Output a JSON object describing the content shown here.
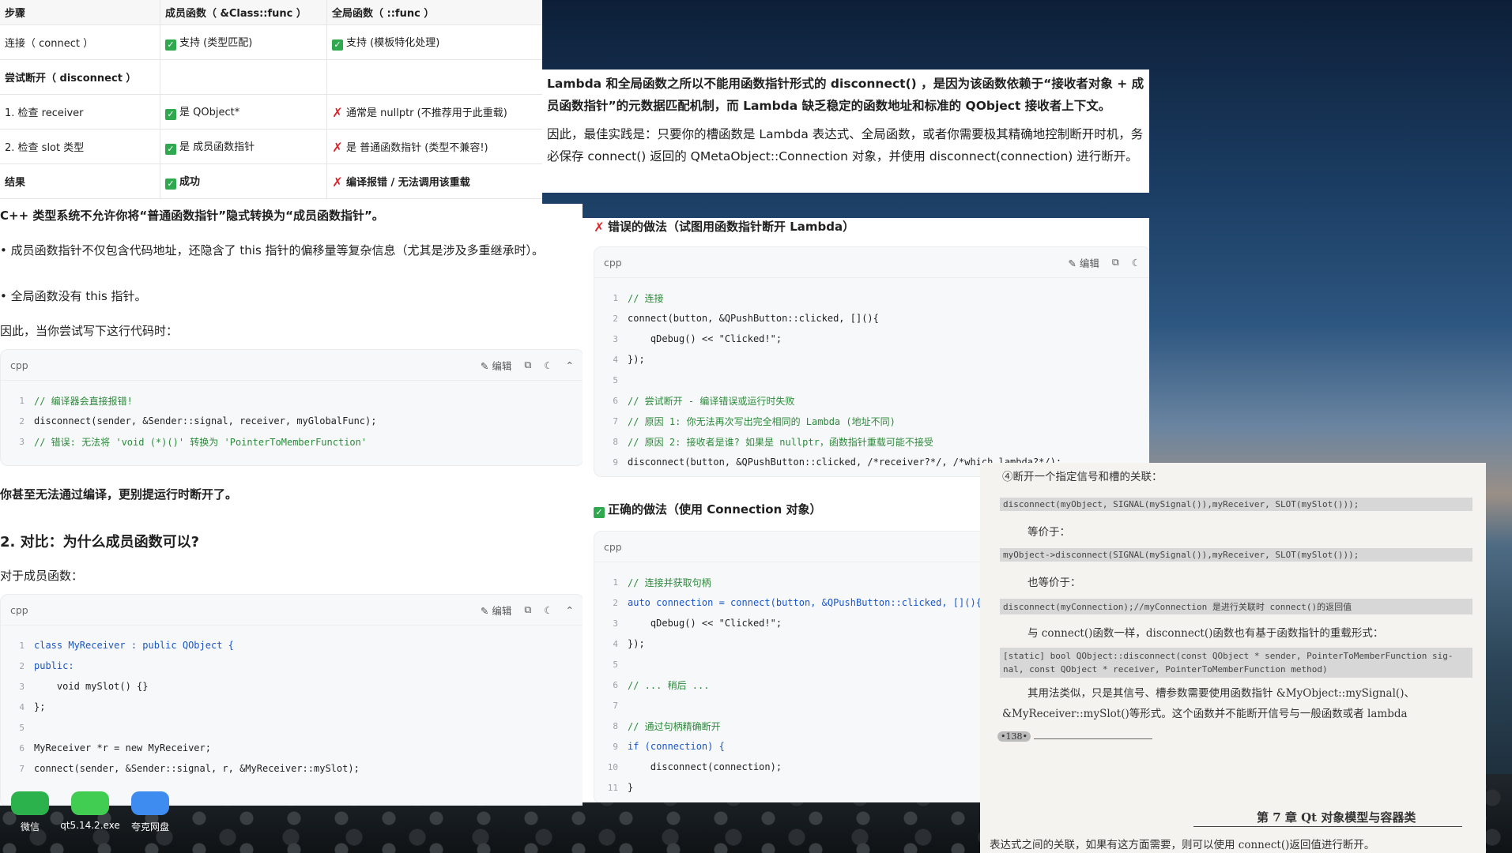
{
  "table": {
    "headers": [
      "步骤",
      "成员函数（ &Class::func ）",
      "全局函数（ ::func ）"
    ],
    "rows": [
      {
        "step": "连接（ connect ）",
        "member": "支持 (类型匹配)",
        "member_mark": "ok",
        "global": "支持 (模板特化处理)",
        "global_mark": "ok"
      },
      {
        "step": "尝试断开（ disconnect ）",
        "member": "",
        "member_mark": "",
        "global": "",
        "global_mark": ""
      },
      {
        "step": "1. 检查 receiver",
        "member": "是 QObject*",
        "member_mark": "ok",
        "global": "通常是 nullptr (不推荐用于此重载)",
        "global_mark": "no"
      },
      {
        "step": "2. 检查 slot 类型",
        "member": "是 成员函数指针",
        "member_mark": "ok",
        "global": "是 普通函数指针 (类型不兼容!)",
        "global_mark": "no"
      },
      {
        "step": "结果",
        "member": "成功",
        "member_mark": "ok",
        "global": "编译报错 / 无法调用该重载",
        "global_mark": "no"
      }
    ]
  },
  "right_text": {
    "p1": "Lambda 和全局函数之所以不能用函数指针形式的 disconnect() ，是因为该函数依赖于“接收者对象 + 成员函数指针”的元数据匹配机制，而 Lambda 缺乏稳定的函数地址和标准的 QObject 接收者上下文。",
    "p2": "因此，最佳实践是：只要你的槽函数是 Lambda 表达式、全局函数，或者你需要极其精确地控制断开时机，务必保存 connect() 返回的 QMetaObject::Connection 对象，并使用 disconnect(connection) 进行断开。"
  },
  "left_article": {
    "heading_line": "C++ 类型系统不允许你将“普通函数指针”隐式转换为“成员函数指针”。",
    "bullet1": "成员函数指针不仅包含代码地址，还隐含了 this 指针的偏移量等复杂信息（尤其是涉及多重继承时）。",
    "bullet2": "全局函数没有 this 指针。",
    "lead1": "因此，当你尝试写下这行代码时：",
    "block1_lang": "cpp",
    "block1": [
      "// 编译器会直接报错!",
      "disconnect(sender, &Sender::signal, receiver, myGlobalFunc);",
      "// 错误: 无法将 'void (*)()' 转换为 'PointerToMemberFunction'"
    ],
    "after1": "你甚至无法通过编译，更别提运行时断开了。",
    "h2": "2. 对比：为什么成员函数可以?",
    "lead2": "对于成员函数：",
    "block2_lang": "cpp",
    "block2": [
      "class MyReceiver : public QObject {",
      "public:",
      "    void mySlot() {}",
      "};",
      "",
      "MyReceiver *r = new MyReceiver;",
      "connect(sender, &Sender::signal, r, &MyReceiver::mySlot);"
    ],
    "tool_edit": "编辑"
  },
  "right_code": {
    "wrong_title": "错误的做法（试图用函数指针断开 Lambda）",
    "wrong_lang": "cpp",
    "wrong_lines": [
      "// 连接",
      "connect(button, &QPushButton::clicked, [](){",
      "    qDebug() << \"Clicked!\";",
      "});",
      "",
      "// 尝试断开 - 编译错误或运行时失败",
      "// 原因 1: 你无法再次写出完全相同的 Lambda (地址不同)",
      "// 原因 2: 接收者是谁? 如果是 nullptr，函数指针重载可能不接受",
      "disconnect(button, &QPushButton::clicked, /*receiver?*/, /*which lambda?*/);"
    ],
    "right_title": "正确的做法（使用 Connection 对象）",
    "right_lang": "cpp",
    "right_lines": [
      "// 连接并获取句柄",
      "auto connection = connect(button, &QPushButton::clicked, [](){",
      "    qDebug() << \"Clicked!\";",
      "});",
      "",
      "// ... 稍后 ...",
      "",
      "// 通过句柄精确断开",
      "if (connection) {",
      "    disconnect(connection);",
      "}"
    ],
    "tool_edit": "编辑"
  },
  "book": {
    "l1": "④断开一个指定信号和槽的关联：",
    "c1": "disconnect(myObject, SIGNAL(mySignal()),myReceiver, SLOT(mySlot()));",
    "l2": "等价于：",
    "c2": "myObject->disconnect(SIGNAL(mySignal()),myReceiver, SLOT(mySlot()));",
    "l3": "也等价于：",
    "c3": "disconnect(myConnection);//myConnection 是进行关联时 connect()的返回值",
    "l4": "与 connect()函数一样，disconnect()函数也有基于函数指针的重载形式：",
    "c4a": "[static] bool QObject::disconnect(const QObject * sender, PointerToMemberFunction sig-",
    "c4b": "nal, const QObject * receiver, PointerToMemberFunction method)",
    "l5": "其用法类似，只是其信号、槽参数需要使用函数指针 &MyObject::mySignal()、",
    "l6": "&MyReceiver::mySlot()等形式。这个函数并不能断开信号与一般函数或者 lambda",
    "page": "•138•",
    "chapter": "第 7 章   Qt 对象模型与容器类",
    "l7": "表达式之间的关联，如果有这方面需要，则可以使用 connect()返回值进行断开。"
  },
  "desktop": {
    "icons": [
      {
        "label": "微信",
        "color": "#2bb24c"
      },
      {
        "label": "qt5.14.2.exe",
        "color": "#41cd52"
      },
      {
        "label": "夸克网盘",
        "color": "#3f8cf0"
      }
    ]
  }
}
